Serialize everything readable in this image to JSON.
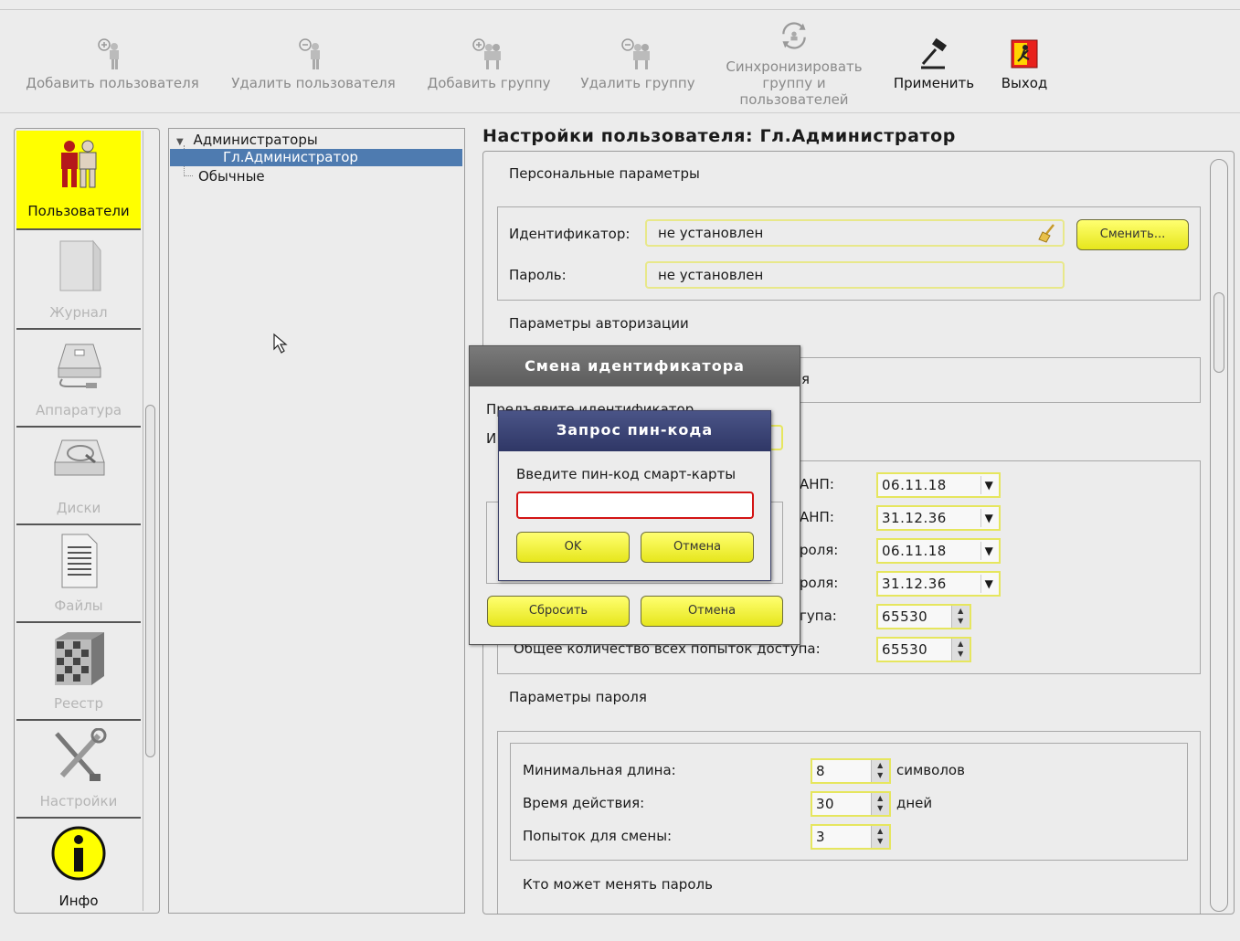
{
  "toolbar": {
    "add_user": "Добавить пользователя",
    "del_user": "Удалить пользователя",
    "add_group": "Добавить группу",
    "del_group": "Удалить группу",
    "sync_l1": "Синхронизировать",
    "sync_l2": "группу и",
    "sync_l3": "пользователей",
    "apply": "Применить",
    "exit": "Выход"
  },
  "sidebar": {
    "items": [
      {
        "label": "Пользователи",
        "icon": "users-icon",
        "active": true
      },
      {
        "label": "Журнал",
        "icon": "journal-icon"
      },
      {
        "label": "Аппаратура",
        "icon": "hardware-icon"
      },
      {
        "label": "Диски",
        "icon": "disk-icon"
      },
      {
        "label": "Файлы",
        "icon": "file-icon"
      },
      {
        "label": "Реестр",
        "icon": "registry-icon"
      },
      {
        "label": "Настройки",
        "icon": "tools-icon"
      },
      {
        "label": "Инфо",
        "icon": "info-icon"
      }
    ]
  },
  "tree": {
    "group1": "Администраторы",
    "user1": "Гл.Администратор",
    "group2": "Обычные"
  },
  "settings": {
    "title": "Настройки пользователя: Гл.Администратор",
    "personal": "Персональные параметры",
    "id_label": "Идентификатор:",
    "id_value": "не установлен",
    "change_btn": "Сменить...",
    "pwd_label": "Пароль:",
    "pwd_value": "не установлен",
    "auth": "Параметры авторизации",
    "auth_partial": "я",
    "rows": [
      {
        "label": "АНП:",
        "value": "06.11.18"
      },
      {
        "label": "АНП:",
        "value": "31.12.36"
      },
      {
        "label": "роля:",
        "value": "06.11.18"
      },
      {
        "label": "роля:",
        "value": "31.12.36"
      },
      {
        "label": "гупа:",
        "value": "65530"
      },
      {
        "label": "Общее количество всех попыток доступа:",
        "value": "65530"
      }
    ],
    "password_params": "Параметры пароля",
    "min_len_label": "Минимальная длина:",
    "min_len_value": "8",
    "min_len_unit": "символов",
    "valid_label": "Время действия:",
    "valid_value": "30",
    "valid_unit": "дней",
    "attempts_label": "Попыток для смены:",
    "attempts_value": "3",
    "who_can_change": "Кто может менять пароль"
  },
  "dialog_change_id": {
    "title": "Смена идентификатора",
    "prompt_partial": "Предъявите идентификатор",
    "field_prefix": "И",
    "reset_btn": "Сбросить",
    "cancel_btn": "Отмена"
  },
  "dialog_pin": {
    "title": "Запрос пин-кода",
    "prompt": "Введите пин-код смарт-карты",
    "pin_value": "",
    "ok_btn": "OK",
    "cancel_btn": "Отмена"
  },
  "colors": {
    "accent_yellow": "#ffff00",
    "selection_blue": "#4e7bb0",
    "pin_title": "#2f3766",
    "error_red": "#d31414"
  }
}
